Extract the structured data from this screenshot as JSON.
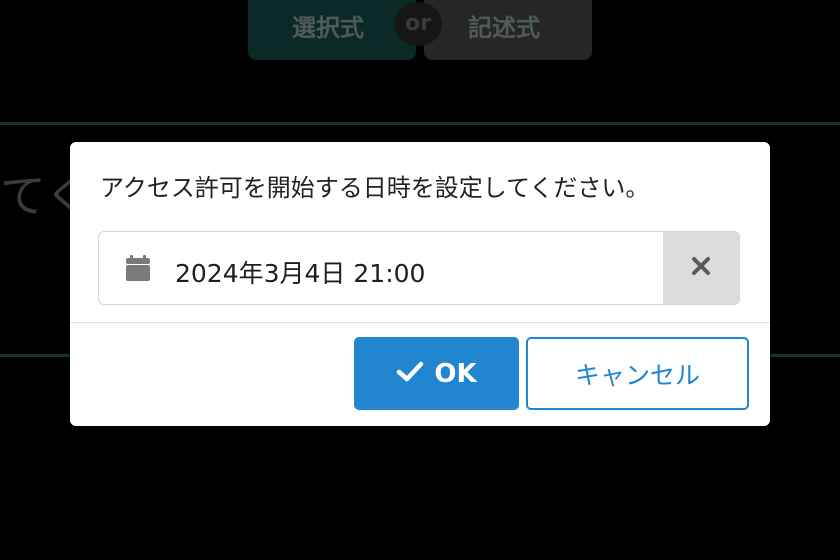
{
  "background": {
    "tab_left_label": "選択式",
    "tab_or_label": "or",
    "tab_right_label": "記述式",
    "partial_text": "てく"
  },
  "dialog": {
    "message": "アクセス許可を開始する日時を設定してください。",
    "date_field": {
      "value": "2024年3月4日 21:00",
      "icon": "calendar-icon",
      "clear_icon": "close-icon"
    },
    "ok_label": "OK",
    "cancel_label": "キャンセル"
  },
  "colors": {
    "primary": "#2185d0",
    "overlay": "#000000",
    "clear_button_bg": "#dcdcdc"
  }
}
